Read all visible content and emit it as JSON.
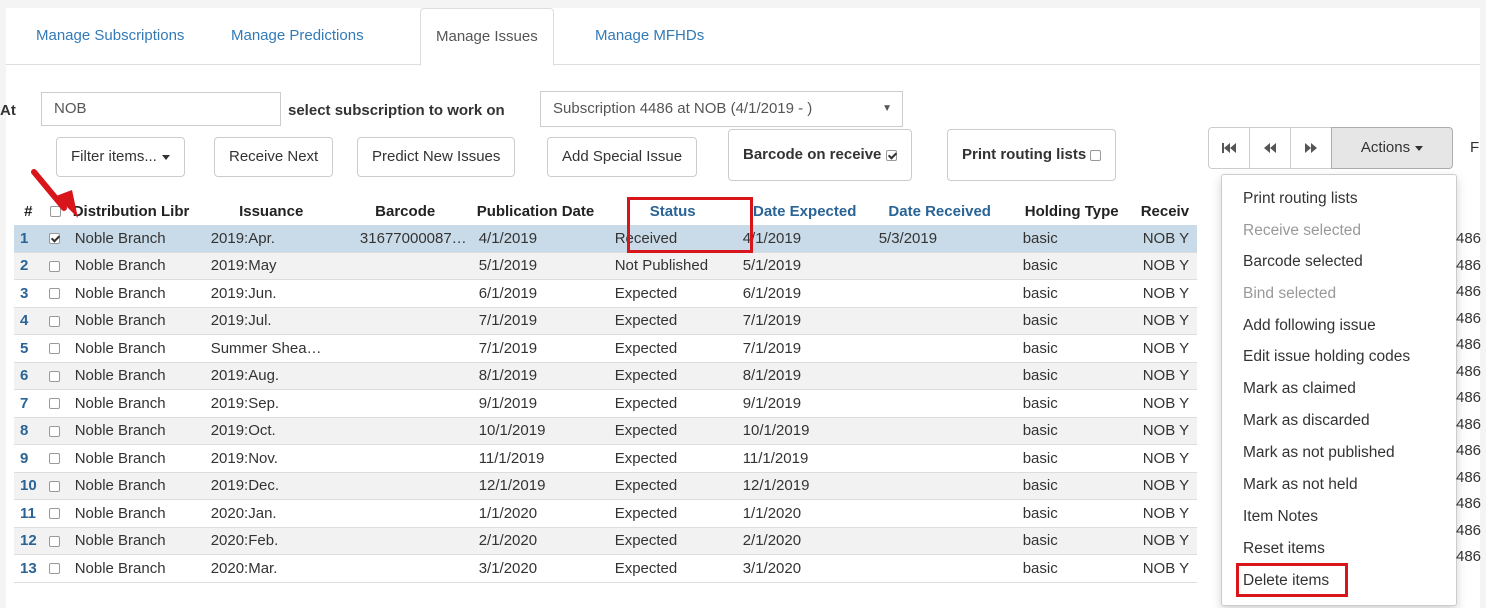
{
  "tabs": [
    {
      "label": "Manage Subscriptions"
    },
    {
      "label": "Manage Predictions"
    },
    {
      "label": "Manage Issues"
    },
    {
      "label": "Manage MFHDs"
    }
  ],
  "at_label": "At",
  "at_value": "NOB",
  "select_label": "select subscription to work on",
  "subscription_value": "Subscription 4486 at NOB (4/1/2019 - )",
  "toolbar": {
    "filter": "Filter items...",
    "receive_next": "Receive Next",
    "predict": "Predict New Issues",
    "add_special": "Add Special Issue",
    "barcode_on_receive": "Barcode on receive",
    "print_routing": "Print routing lists",
    "actions": "Actions",
    "cut_label": "F"
  },
  "columns": [
    "#",
    "",
    "Distribution Libr",
    "Issuance",
    "Barcode",
    "Publication Date",
    "Status",
    "Date Expected",
    "Date Received",
    "Holding Type",
    "Receiv"
  ],
  "rows": [
    {
      "n": "1",
      "checked": true,
      "lib": "Noble Branch",
      "iss": "2019:Apr.",
      "bc": "31677000087…",
      "pub": "4/1/2019",
      "status": "Received",
      "exp": "4/1/2019",
      "rec": "5/3/2019",
      "type": "basic",
      "recv": "NOB Y",
      "tail": "486"
    },
    {
      "n": "2",
      "checked": false,
      "lib": "Noble Branch",
      "iss": "2019:May",
      "bc": "",
      "pub": "5/1/2019",
      "status": "Not Published",
      "exp": "5/1/2019",
      "rec": "",
      "type": "basic",
      "recv": "NOB Y",
      "tail": "486"
    },
    {
      "n": "3",
      "checked": false,
      "lib": "Noble Branch",
      "iss": "2019:Jun.",
      "bc": "",
      "pub": "6/1/2019",
      "status": "Expected",
      "exp": "6/1/2019",
      "rec": "",
      "type": "basic",
      "recv": "NOB Y",
      "tail": "486"
    },
    {
      "n": "4",
      "checked": false,
      "lib": "Noble Branch",
      "iss": "2019:Jul.",
      "bc": "",
      "pub": "7/1/2019",
      "status": "Expected",
      "exp": "7/1/2019",
      "rec": "",
      "type": "basic",
      "recv": "NOB Y",
      "tail": "486"
    },
    {
      "n": "5",
      "checked": false,
      "lib": "Noble Branch",
      "iss": "Summer Shea…",
      "bc": "",
      "pub": "7/1/2019",
      "status": "Expected",
      "exp": "7/1/2019",
      "rec": "",
      "type": "basic",
      "recv": "NOB Y",
      "tail": "486"
    },
    {
      "n": "6",
      "checked": false,
      "lib": "Noble Branch",
      "iss": "2019:Aug.",
      "bc": "",
      "pub": "8/1/2019",
      "status": "Expected",
      "exp": "8/1/2019",
      "rec": "",
      "type": "basic",
      "recv": "NOB Y",
      "tail": "486"
    },
    {
      "n": "7",
      "checked": false,
      "lib": "Noble Branch",
      "iss": "2019:Sep.",
      "bc": "",
      "pub": "9/1/2019",
      "status": "Expected",
      "exp": "9/1/2019",
      "rec": "",
      "type": "basic",
      "recv": "NOB Y",
      "tail": "486"
    },
    {
      "n": "8",
      "checked": false,
      "lib": "Noble Branch",
      "iss": "2019:Oct.",
      "bc": "",
      "pub": "10/1/2019",
      "status": "Expected",
      "exp": "10/1/2019",
      "rec": "",
      "type": "basic",
      "recv": "NOB Y",
      "tail": "486"
    },
    {
      "n": "9",
      "checked": false,
      "lib": "Noble Branch",
      "iss": "2019:Nov.",
      "bc": "",
      "pub": "11/1/2019",
      "status": "Expected",
      "exp": "11/1/2019",
      "rec": "",
      "type": "basic",
      "recv": "NOB Y",
      "tail": "486"
    },
    {
      "n": "10",
      "checked": false,
      "lib": "Noble Branch",
      "iss": "2019:Dec.",
      "bc": "",
      "pub": "12/1/2019",
      "status": "Expected",
      "exp": "12/1/2019",
      "rec": "",
      "type": "basic",
      "recv": "NOB Y",
      "tail": "486"
    },
    {
      "n": "11",
      "checked": false,
      "lib": "Noble Branch",
      "iss": "2020:Jan.",
      "bc": "",
      "pub": "1/1/2020",
      "status": "Expected",
      "exp": "1/1/2020",
      "rec": "",
      "type": "basic",
      "recv": "NOB Y",
      "tail": "486"
    },
    {
      "n": "12",
      "checked": false,
      "lib": "Noble Branch",
      "iss": "2020:Feb.",
      "bc": "",
      "pub": "2/1/2020",
      "status": "Expected",
      "exp": "2/1/2020",
      "rec": "",
      "type": "basic",
      "recv": "NOB Y",
      "tail": "486"
    },
    {
      "n": "13",
      "checked": false,
      "lib": "Noble Branch",
      "iss": "2020:Mar.",
      "bc": "",
      "pub": "3/1/2020",
      "status": "Expected",
      "exp": "3/1/2020",
      "rec": "",
      "type": "basic",
      "recv": "NOB Y",
      "tail": "486"
    }
  ],
  "menu": [
    {
      "label": "Print routing lists",
      "disabled": false
    },
    {
      "label": "Receive selected",
      "disabled": true
    },
    {
      "label": "Barcode selected",
      "disabled": false
    },
    {
      "label": "Bind selected",
      "disabled": true
    },
    {
      "label": "Add following issue",
      "disabled": false
    },
    {
      "label": "Edit issue holding codes",
      "disabled": false
    },
    {
      "label": "Mark as claimed",
      "disabled": false
    },
    {
      "label": "Mark as discarded",
      "disabled": false
    },
    {
      "label": "Mark as not published",
      "disabled": false
    },
    {
      "label": "Mark as not held",
      "disabled": false
    },
    {
      "label": "Item Notes",
      "disabled": false
    },
    {
      "label": "Reset items",
      "disabled": false
    },
    {
      "label": "Delete items",
      "disabled": false
    }
  ],
  "colors": {
    "link": "#337ab7",
    "highlight": "#d9151c",
    "selected_row": "#c9dbe8"
  }
}
